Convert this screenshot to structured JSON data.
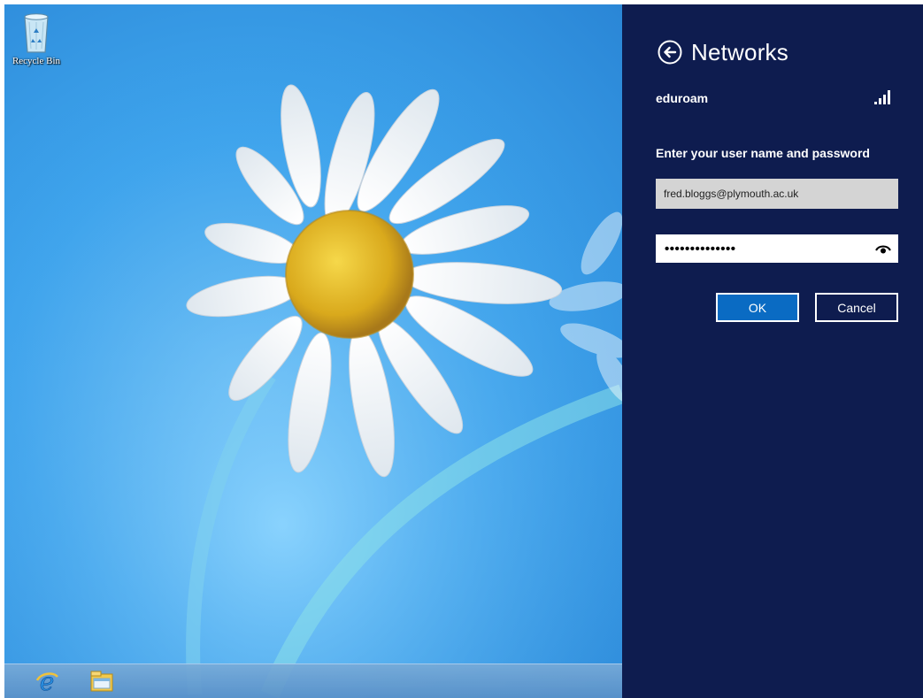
{
  "desktop": {
    "icons": [
      {
        "label": "Recycle Bin",
        "icon": "recycle-bin-icon"
      }
    ]
  },
  "taskbar": {
    "items": [
      {
        "icon": "internet-explorer-icon"
      },
      {
        "icon": "file-explorer-icon"
      }
    ]
  },
  "flyout": {
    "title": "Networks",
    "back_icon": "back-arrow-icon",
    "network": {
      "name": "eduroam",
      "signal_icon": "wifi-signal-icon"
    },
    "prompt": "Enter your user name and password",
    "username": {
      "value": "fred.bloggs@plymouth.ac.uk"
    },
    "password": {
      "value": "••••••••••••••",
      "reveal_icon": "eye-icon"
    },
    "buttons": {
      "ok": "OK",
      "cancel": "Cancel"
    }
  },
  "colors": {
    "flyout_background": "#0e1c4f",
    "ok_button": "#0a6bc3",
    "username_field": "#d4d4d4",
    "taskbar": "#6ea0d4"
  }
}
